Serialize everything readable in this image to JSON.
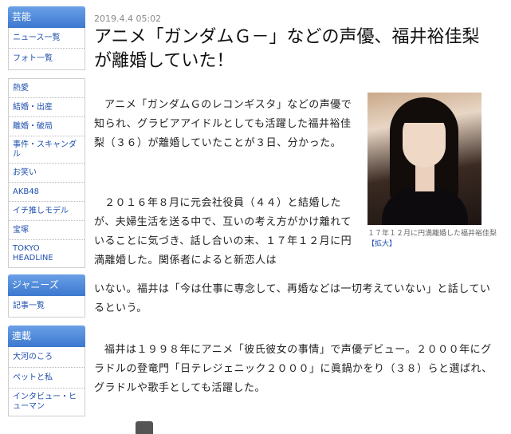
{
  "sidebar": {
    "entertainment": {
      "head": "芸能",
      "items": [
        "ニュース一覧",
        "フォト一覧"
      ]
    },
    "topics": {
      "items": [
        "熱愛",
        "結婚・出産",
        "離婚・破局",
        "事件・スキャンダル",
        "お笑い",
        "AKB48",
        "イチ推しモデル",
        "宝塚",
        "TOKYO HEADLINE"
      ]
    },
    "johnnys": {
      "head": "ジャニーズ",
      "items": [
        "記事一覧"
      ]
    },
    "serial": {
      "head": "連載",
      "items": [
        "大河のころ",
        "ペットと私",
        "インタビュー・ヒューマン"
      ]
    }
  },
  "article": {
    "date": "2019.4.4 05:02",
    "title": "アニメ「ガンダムＧ－」などの声優、福井裕佳梨が離婚していた！",
    "p1": "アニメ「ガンダムＧのレコンギスタ」などの声優で知られ、グラビアアイドルとしても活躍した福井裕佳梨（３６）が離婚していたことが３日、分かった。",
    "p2": "２０１６年８月に元会社役員（４４）と結婚したが、夫婦生活を送る中で、互いの考え方がかけ離れていることに気づき、話し合いの末、１７年１２月に円満離婚した。関係者によると新恋人はいない。福井は「今は仕事に専念して、再婚などは一切考えていない」と話しているという。",
    "p3": "福井は１９９８年にアニメ「彼氏彼女の事情」で声優デビュー。２０００年にグラドルの登竜門「日テレジェニック２０００」に眞鍋かをり（３８）らと選ばれ、グラドルや歌手としても活躍した。",
    "caption": "１７年１２月に円満離婚した福井裕佳梨",
    "enlarge": "【拡大】"
  }
}
